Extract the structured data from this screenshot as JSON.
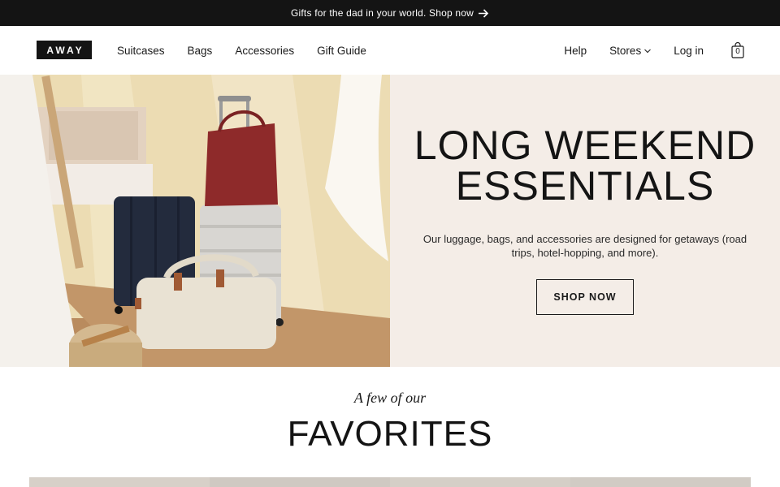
{
  "promo": {
    "text": "Gifts for the dad in your world. Shop now"
  },
  "brand": {
    "logo_text": "AWAY"
  },
  "nav": {
    "left": [
      "Suitcases",
      "Bags",
      "Accessories",
      "Gift Guide"
    ],
    "help": "Help",
    "stores": "Stores",
    "login": "Log in",
    "cart_count": "0"
  },
  "hero": {
    "headline_line1": "LONG WEEKEND",
    "headline_line2": "ESSENTIALS",
    "subtext": "Our luggage, bags, and accessories are designed for getaways (road trips, hotel-hopping, and more).",
    "cta": "SHOP NOW"
  },
  "favorites": {
    "pretitle": "A few of our",
    "title": "FAVORITES"
  },
  "colors": {
    "promo_bg": "#141414",
    "hero_panel_bg": "#f4ede7",
    "text": "#1a1a1a"
  },
  "icons": {
    "promo_arrow": "arrow-right-icon",
    "stores_chevron": "chevron-down-icon",
    "cart": "shopping-bag-icon"
  }
}
